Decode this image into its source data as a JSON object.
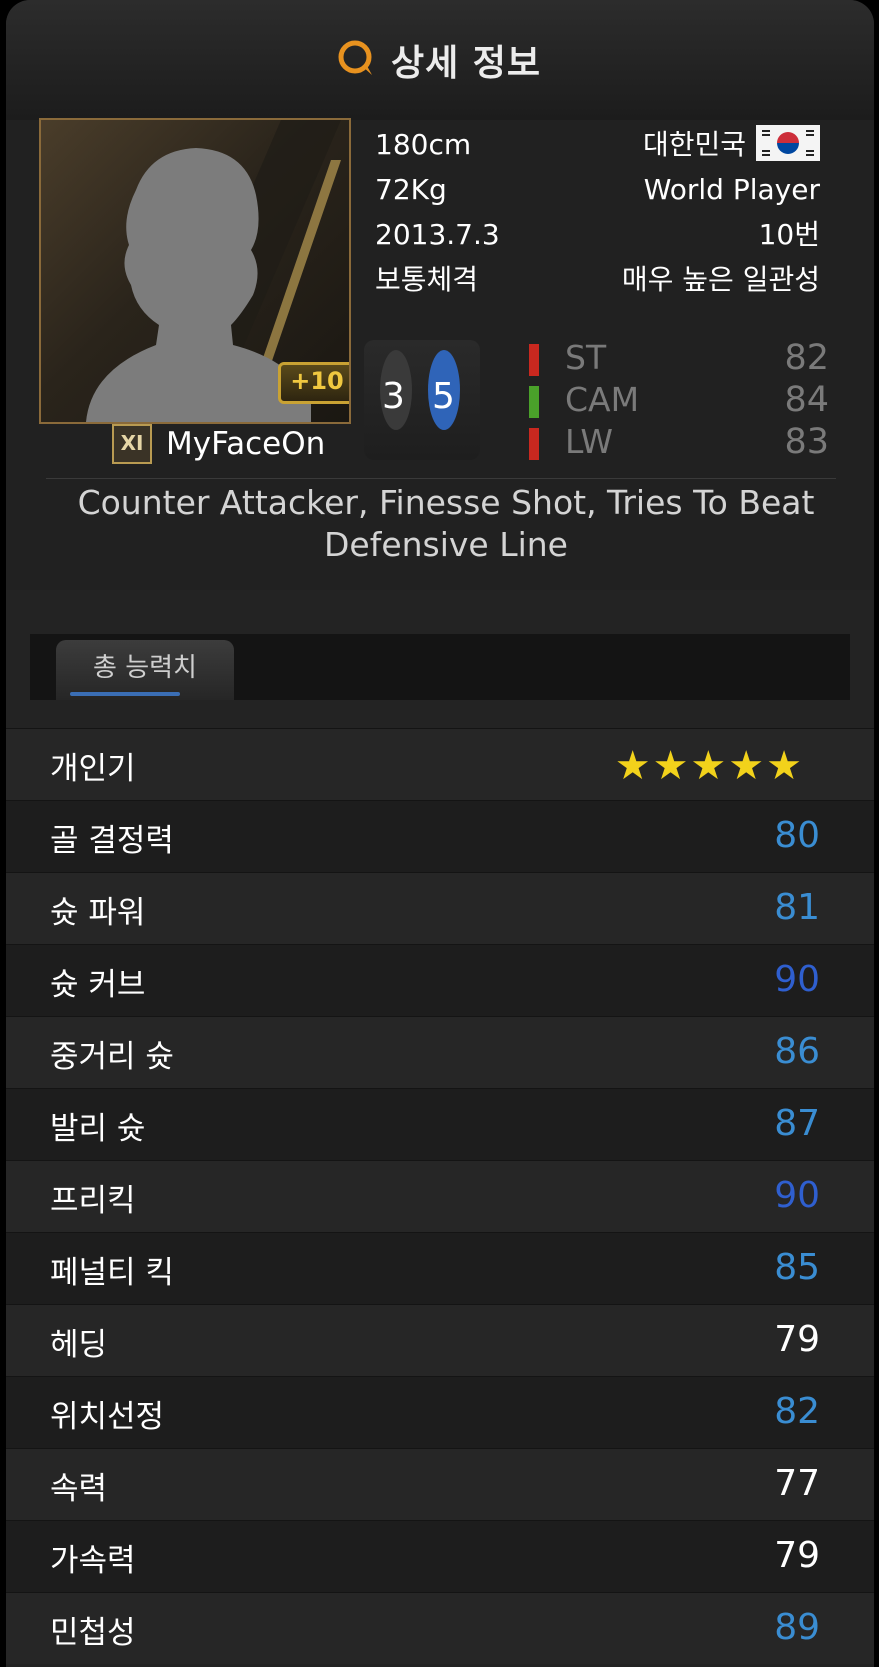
{
  "header": {
    "title": "상세 정보",
    "icon": "speech-bubble-icon"
  },
  "player": {
    "name": "MyFaceOn",
    "badge": "XI",
    "enhance": "+10",
    "height": "180cm",
    "weight": "72Kg",
    "date": "2013.7.3",
    "body_type": "보통체격",
    "country": "대한민국",
    "class": "World Player",
    "number": "10번",
    "consistency": "매우 높은 일관성",
    "left_foot": "3",
    "right_foot": "5"
  },
  "positions": [
    {
      "name": "ST",
      "value": "82",
      "color": "#c9281f"
    },
    {
      "name": "CAM",
      "value": "84",
      "color": "#4aa12a"
    },
    {
      "name": "LW",
      "value": "83",
      "color": "#c9281f"
    }
  ],
  "traits": "Counter Attacker, Finesse Shot, Tries To Beat Defensive Line",
  "tabs": [
    {
      "label": "총 능력치"
    }
  ],
  "popularity": {
    "label": "개인기",
    "stars": 5,
    "star_text": "★★★★★"
  },
  "stats": [
    {
      "label": "골 결정력",
      "value": "80",
      "color": "#3a8dd2"
    },
    {
      "label": "슛 파워",
      "value": "81",
      "color": "#3a8dd2"
    },
    {
      "label": "슛 커브",
      "value": "90",
      "color": "#2f5fcf"
    },
    {
      "label": "중거리 슛",
      "value": "86",
      "color": "#3a8dd2"
    },
    {
      "label": "발리 슛",
      "value": "87",
      "color": "#3a8dd2"
    },
    {
      "label": "프리킥",
      "value": "90",
      "color": "#2f5fcf"
    },
    {
      "label": "페널티 킥",
      "value": "85",
      "color": "#3a8dd2"
    },
    {
      "label": "헤딩",
      "value": "79",
      "color": "#ffffff"
    },
    {
      "label": "위치선정",
      "value": "82",
      "color": "#3a8dd2"
    },
    {
      "label": "속력",
      "value": "77",
      "color": "#ffffff"
    },
    {
      "label": "가속력",
      "value": "79",
      "color": "#ffffff"
    },
    {
      "label": "민첩성",
      "value": "89",
      "color": "#3a8dd2"
    }
  ]
}
